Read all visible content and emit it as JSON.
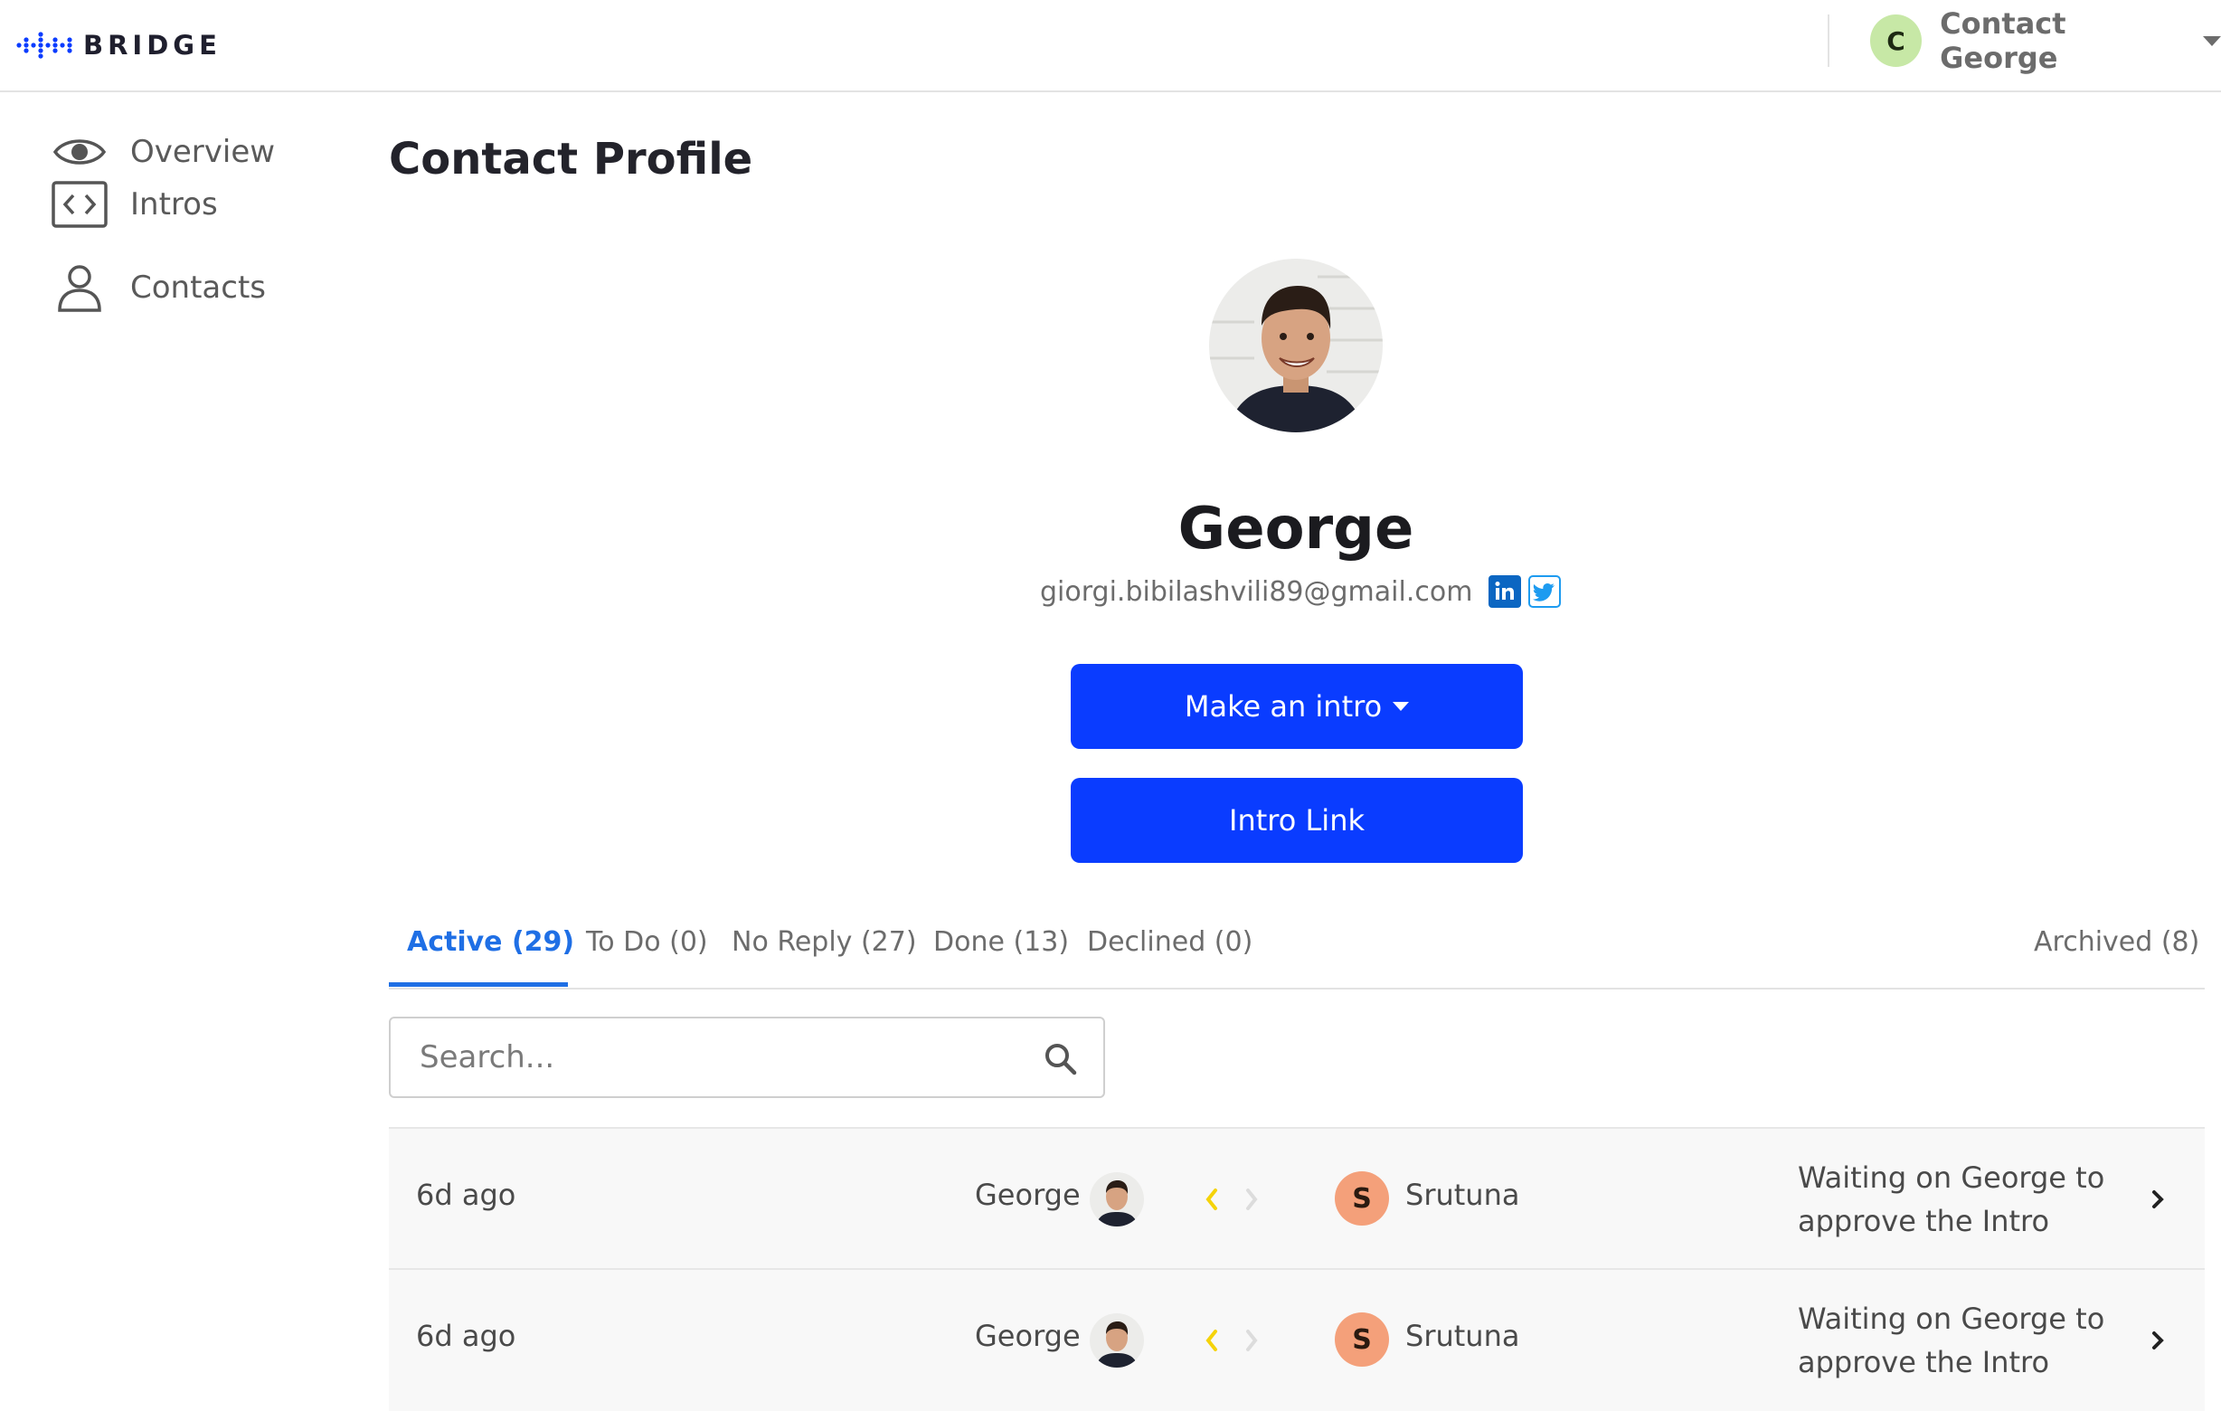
{
  "brand": {
    "name": "BRIDGE",
    "color": "#0a3cff"
  },
  "header": {
    "user_initial": "C",
    "user_name": "Contact George"
  },
  "sidebar": {
    "items": [
      {
        "label": "Overview",
        "icon": "eye-icon"
      },
      {
        "label": "Intros",
        "icon": "code-brackets-icon"
      },
      {
        "label": "Contacts",
        "icon": "person-icon"
      }
    ]
  },
  "main": {
    "title": "Contact Profile",
    "contact": {
      "name": "George",
      "email": "giorgi.bibilashvili89@gmail.com",
      "social": [
        "linkedin-icon",
        "twitter-icon"
      ]
    },
    "actions": {
      "make_intro": "Make an intro",
      "intro_link": "Intro Link"
    },
    "tabs": [
      {
        "label": "Active (29)",
        "active": true
      },
      {
        "label": "To Do (0)"
      },
      {
        "label": "No Reply (27)"
      },
      {
        "label": "Done (13)"
      },
      {
        "label": "Declined (0)"
      },
      {
        "label": "Archived (8)"
      }
    ],
    "search": {
      "placeholder": "Search..."
    },
    "rows": [
      {
        "time": "6d ago",
        "from": "George",
        "to_initial": "S",
        "to": "Srutuna",
        "status": "Waiting on George to approve the Intro"
      },
      {
        "time": "6d ago",
        "from": "George",
        "to_initial": "S",
        "to": "Srutuna",
        "status": "Waiting on George to approve the Intro"
      }
    ]
  },
  "colors": {
    "accent": "#0a3cff",
    "tab_active": "#1f6fe5",
    "user_avatar": "#c7e8a6",
    "contact_avatar": "#f4a07a",
    "arrow_active": "#f5d30a"
  }
}
